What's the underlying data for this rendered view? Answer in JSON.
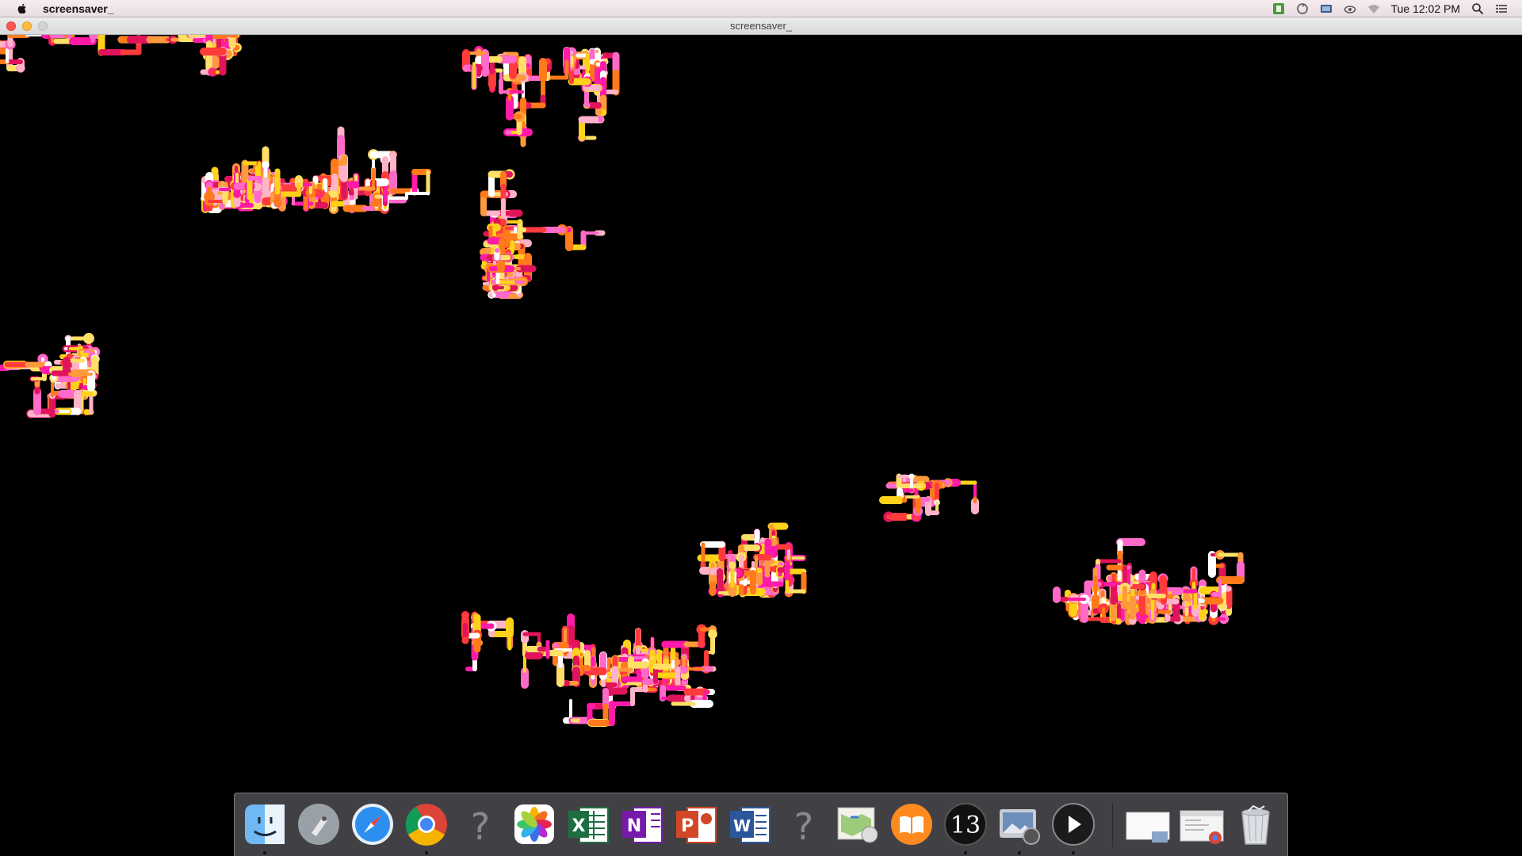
{
  "menubar": {
    "app_name": "screensaver_",
    "clock": "Tue 12:02 PM",
    "status_icons": [
      "evernote-icon",
      "sync-icon",
      "display-icon",
      "cloud-icon",
      "wifi-icon",
      "spotlight-icon",
      "notification-center-icon"
    ]
  },
  "window": {
    "title": "screensaver_"
  },
  "screensaver": {
    "background": "#000000",
    "palette": [
      "#ff1aa8",
      "#ff3b3b",
      "#ff7a1a",
      "#ffd21a",
      "#ff69c8",
      "#ffb3c8",
      "#ff9a3c",
      "#ffe066",
      "#ffffff",
      "#e0145a"
    ]
  },
  "dock": {
    "items": [
      {
        "name": "finder-icon",
        "running": true
      },
      {
        "name": "launchpad-icon",
        "running": false
      },
      {
        "name": "safari-icon",
        "running": false
      },
      {
        "name": "chrome-icon",
        "running": true
      },
      {
        "name": "unknown-app-icon",
        "running": false
      },
      {
        "name": "photos-icon",
        "running": false
      },
      {
        "name": "excel-icon",
        "running": false
      },
      {
        "name": "onenote-icon",
        "running": false
      },
      {
        "name": "powerpoint-icon",
        "running": false
      },
      {
        "name": "word-icon",
        "running": false
      },
      {
        "name": "unknown-app-icon",
        "running": false
      },
      {
        "name": "preview-maps-icon",
        "running": false
      },
      {
        "name": "ibooks-icon",
        "running": false
      },
      {
        "name": "processing-icon",
        "running": true
      },
      {
        "name": "image-capture-icon",
        "running": true
      },
      {
        "name": "quicktime-icon",
        "running": true
      },
      {
        "name": "downloads-stack-icon",
        "running": false
      },
      {
        "name": "chrome-window-stack-icon",
        "running": false
      },
      {
        "name": "trash-icon",
        "running": false
      }
    ]
  }
}
